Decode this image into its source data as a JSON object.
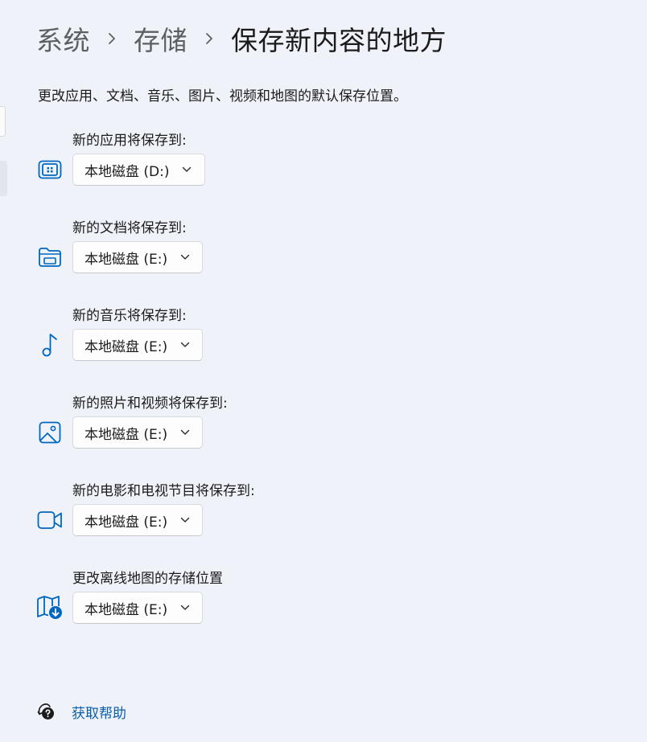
{
  "breadcrumb": {
    "items": [
      "系统",
      "存储",
      "保存新内容的地方"
    ]
  },
  "description": "更改应用、文档、音乐、图片、视频和地图的默认保存位置。",
  "rows": [
    {
      "label": "新的应用将保存到:",
      "value": "本地磁盘 (D:)",
      "icon": "apps-icon"
    },
    {
      "label": "新的文档将保存到:",
      "value": "本地磁盘 (E:)",
      "icon": "documents-folder-icon"
    },
    {
      "label": "新的音乐将保存到:",
      "value": "本地磁盘 (E:)",
      "icon": "music-note-icon"
    },
    {
      "label": "新的照片和视频将保存到:",
      "value": "本地磁盘 (E:)",
      "icon": "picture-icon"
    },
    {
      "label": "新的电影和电视节目将保存到:",
      "value": "本地磁盘 (E:)",
      "icon": "video-camera-icon"
    },
    {
      "label": "更改离线地图的存储位置",
      "value": "本地磁盘 (E:)",
      "icon": "offline-map-icon"
    }
  ],
  "help": {
    "label": "获取帮助",
    "icon": "help-icon"
  },
  "colors": {
    "accent": "#0067c0",
    "link": "#0b5cad",
    "background": "#eff3f9"
  }
}
